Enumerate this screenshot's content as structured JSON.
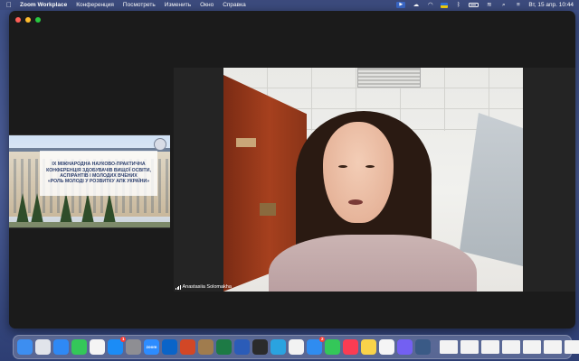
{
  "menubar": {
    "app_name": "Zoom Workplace",
    "menus": [
      "Конференция",
      "Посмотреть",
      "Изменить",
      "Окно",
      "Справка"
    ],
    "datetime": "Вт, 15 апр.  10:44",
    "status_icons": [
      "zoom-status-icon",
      "creative-cloud-icon",
      "wifi-status-icon",
      "ukraine-flag-icon",
      "bluetooth-icon",
      "battery-icon",
      "wifi-icon",
      "search-icon",
      "control-center-icon"
    ]
  },
  "zoom": {
    "speaker_name": "Anastasiia Solomakha",
    "shared_slide": {
      "lines": [
        "IX МІЖНАРОДНА НАУКОВО-ПРАКТИЧНА",
        "КОНФЕРЕНЦІЯ ЗДОБУВАЧІВ ВИЩОЇ ОСВІТИ,",
        "АСПІРАНТІВ І МОЛОДИХ ВЧЕНИХ",
        "«РОЛЬ МОЛОДІ У РОЗВИТКУ АПК УКРАЇНИ»"
      ]
    }
  },
  "dock": {
    "apps": [
      {
        "name": "finder-icon",
        "color": "#3d8ef0"
      },
      {
        "name": "launchpad-icon",
        "color": "#e1e4ea"
      },
      {
        "name": "safari-icon",
        "color": "#2f89f5"
      },
      {
        "name": "facetime-icon",
        "color": "#34c759"
      },
      {
        "name": "photos-icon",
        "color": "#f4f4f4"
      },
      {
        "name": "app-store-icon",
        "color": "#1b8cf6",
        "badge": "1"
      },
      {
        "name": "system-settings-icon",
        "color": "#8e8e93"
      },
      {
        "name": "zoom-icon",
        "color": "#2d8cff",
        "label": "zoom"
      },
      {
        "name": "outlook-icon",
        "color": "#0a64c8"
      },
      {
        "name": "powerpoint-icon",
        "color": "#d24726"
      },
      {
        "name": "preview-icon",
        "color": "#a07c4e"
      },
      {
        "name": "excel-icon",
        "color": "#1d7a45"
      },
      {
        "name": "word-icon",
        "color": "#2b5cb8"
      },
      {
        "name": "terminal-icon",
        "color": "#2b2b2b"
      },
      {
        "name": "telegram-icon",
        "color": "#2aa3e0"
      },
      {
        "name": "chrome-icon",
        "color": "#f2f2f2"
      },
      {
        "name": "mail-icon",
        "color": "#2f8cf0",
        "badge": "2"
      },
      {
        "name": "messages-icon",
        "color": "#34c759"
      },
      {
        "name": "music-icon",
        "color": "#fa3c53"
      },
      {
        "name": "notes-icon",
        "color": "#f9d34a"
      },
      {
        "name": "calendar-icon",
        "color": "#f5f5f5"
      },
      {
        "name": "viber-icon",
        "color": "#7360f2"
      },
      {
        "name": "utility-icon",
        "color": "#3a5a86"
      }
    ]
  }
}
